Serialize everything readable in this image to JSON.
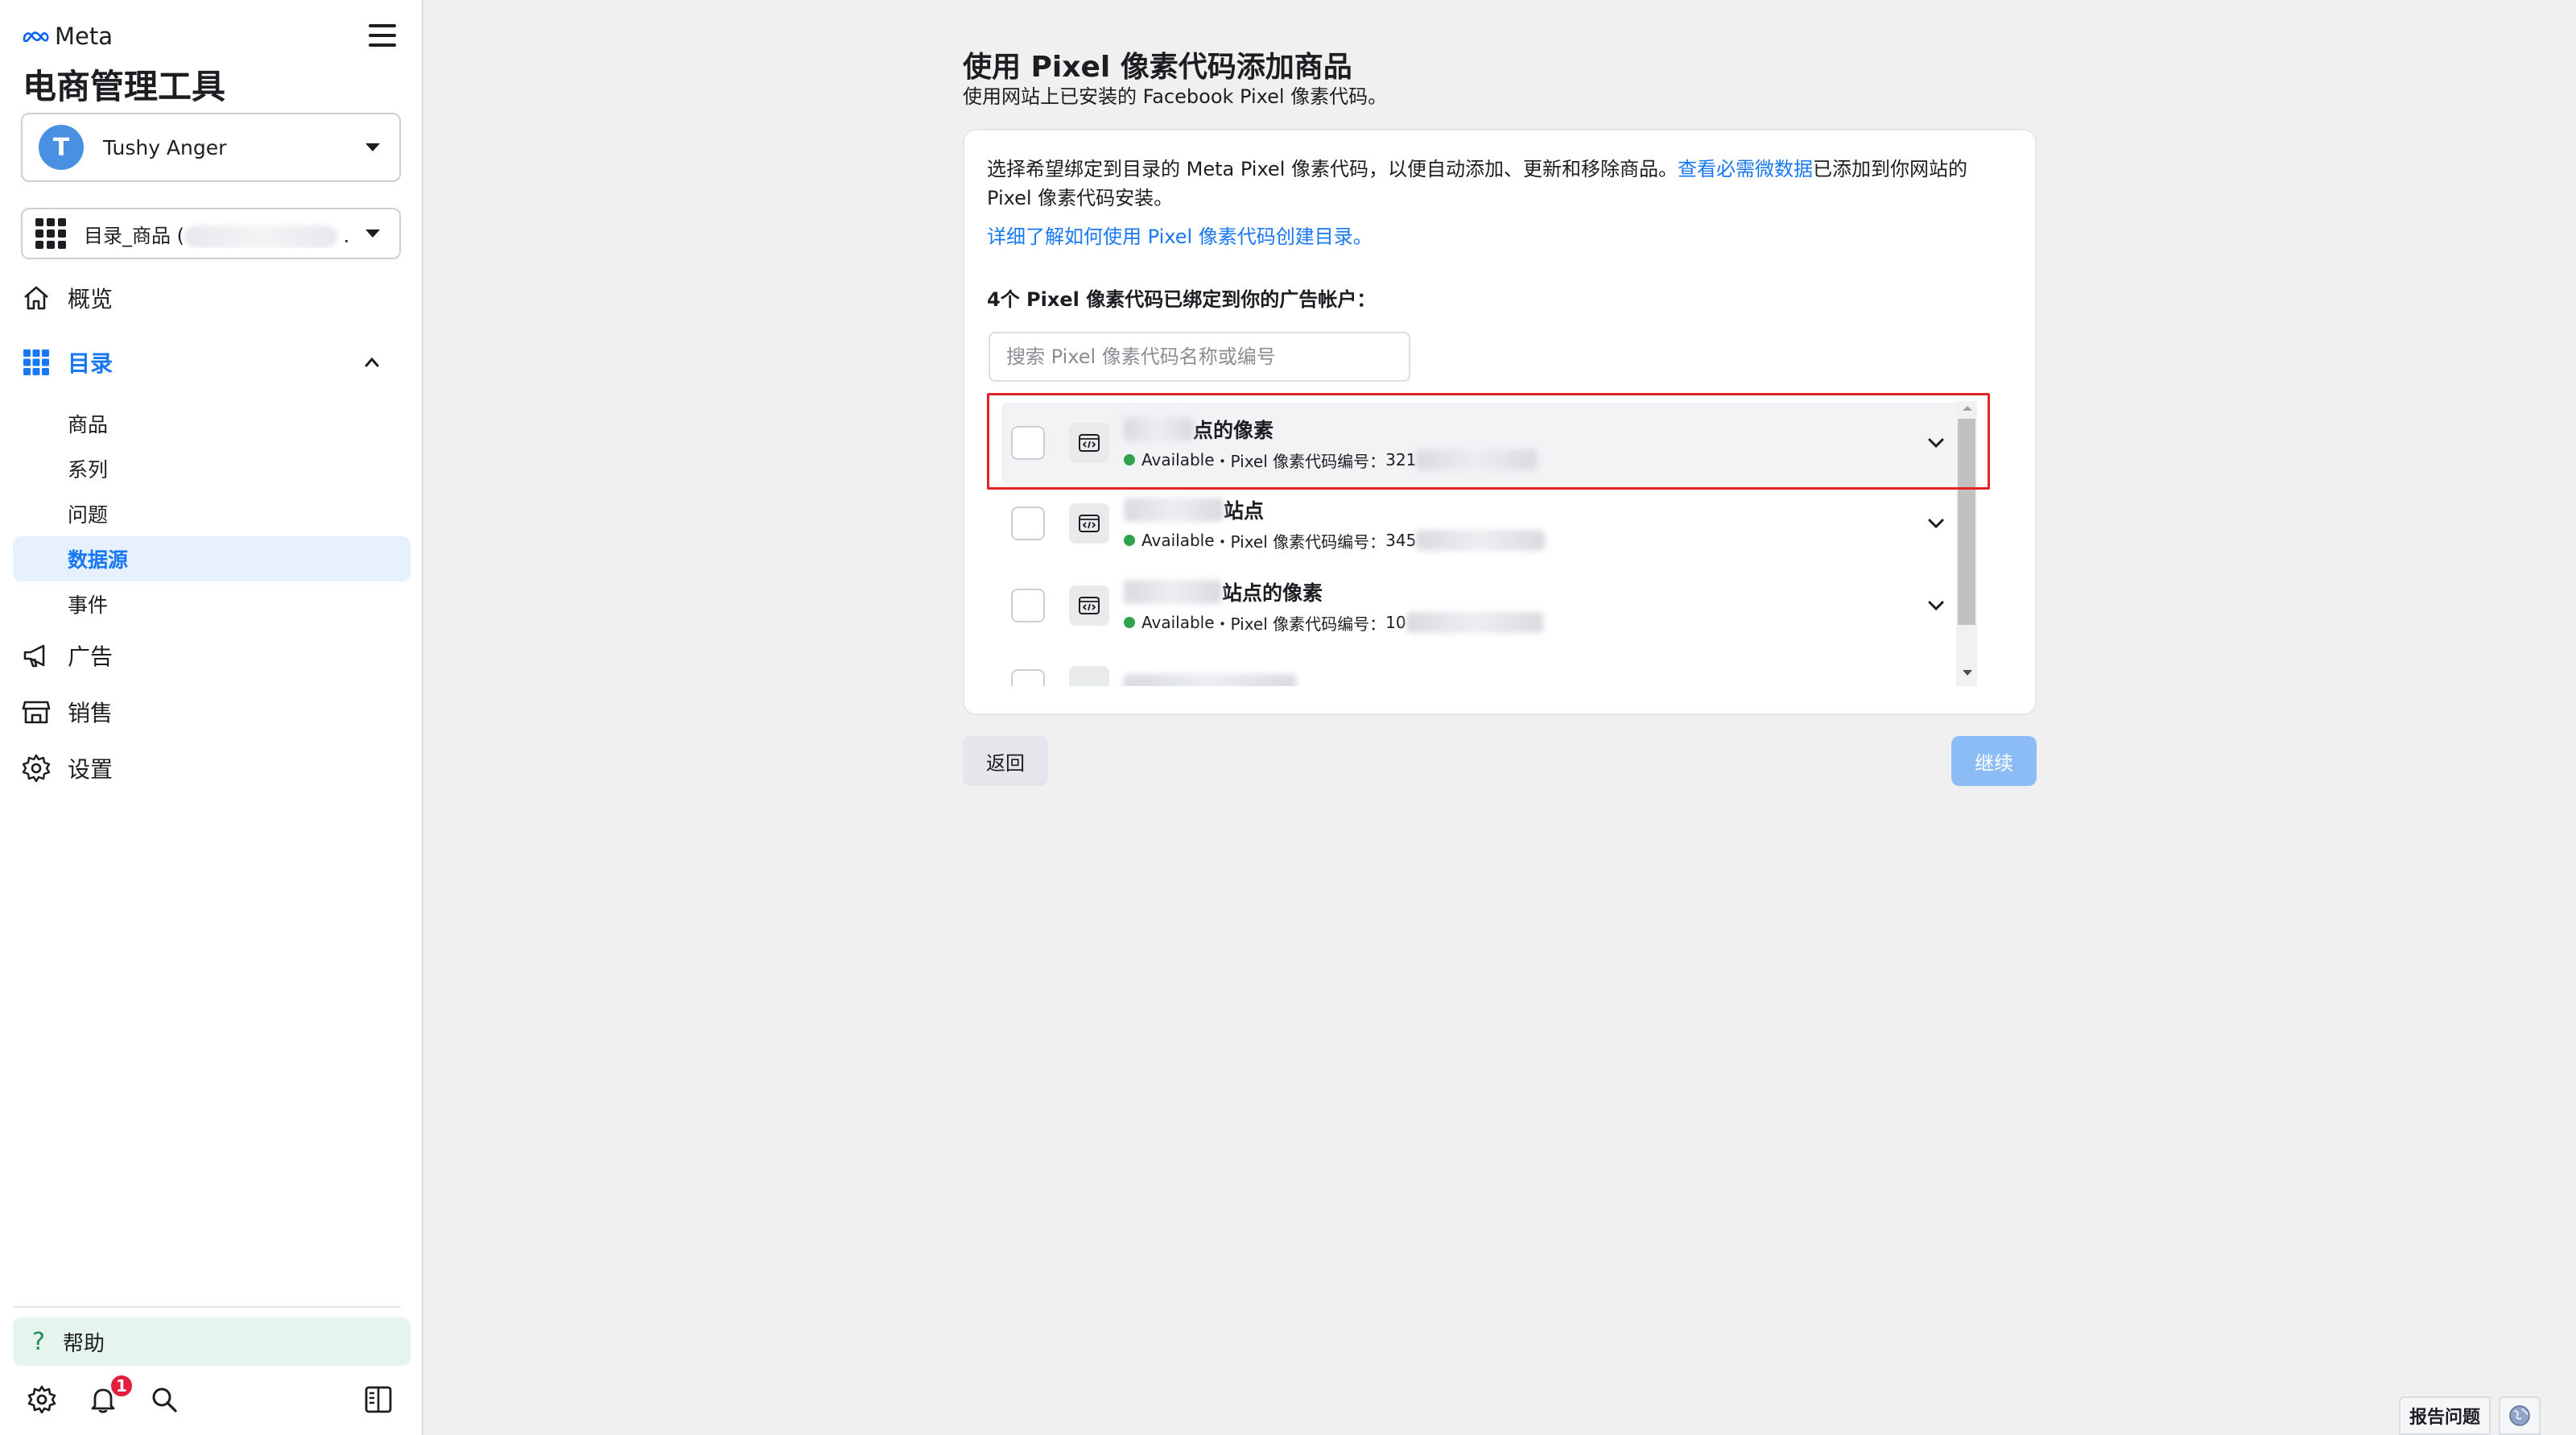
{
  "sidebar": {
    "brand": "Meta",
    "app_title": "电商管理工具",
    "account": {
      "initial": "T",
      "name": "Tushy Anger"
    },
    "catalog": {
      "label": "目录_商品 (",
      "suffix": "."
    },
    "nav": {
      "overview": "概览",
      "catalog": "目录",
      "ads": "广告",
      "sales": "销售",
      "settings": "设置"
    },
    "sub_nav": {
      "products": "商品",
      "sets": "系列",
      "issues": "问题",
      "data_sources": "数据源",
      "events": "事件"
    },
    "help": "帮助",
    "notification_count": "1"
  },
  "main": {
    "title": "使用 Pixel 像素代码添加商品",
    "subtitle": "使用网站上已安装的 Facebook Pixel 像素代码。",
    "desc_prefix": "选择希望绑定到目录的 Meta Pixel 像素代码，以便自动添加、更新和移除商品。",
    "desc_link": "查看必需微数据",
    "desc_suffix": "已添加到你网站的 Pixel 像素代码安装。",
    "learn_more": "详细了解如何使用 Pixel 像素代码创建目录。",
    "count_label": "4个 Pixel 像素代码已绑定到你的广告帐户：",
    "search_placeholder": "搜索 Pixel 像素代码名称或编号",
    "pixels": [
      {
        "name_visible": "点的像素",
        "status": "Available",
        "meta_prefix": "・Pixel 像素代码编号：",
        "id_visible": "321"
      },
      {
        "name_visible": "站点",
        "status": "Available",
        "meta_prefix": "・Pixel 像素代码编号：",
        "id_visible": "345"
      },
      {
        "name_visible": "站点的像素",
        "status": "Available",
        "meta_prefix": "・Pixel 像素代码编号：",
        "id_visible": "10"
      }
    ],
    "back_label": "返回",
    "continue_label": "继续"
  },
  "footer": {
    "report": "报告问题"
  },
  "colors": {
    "accent": "#1877f2",
    "available": "#31a24c",
    "highlight_border": "#e02424",
    "continue_disabled": "#8cbcf6"
  }
}
